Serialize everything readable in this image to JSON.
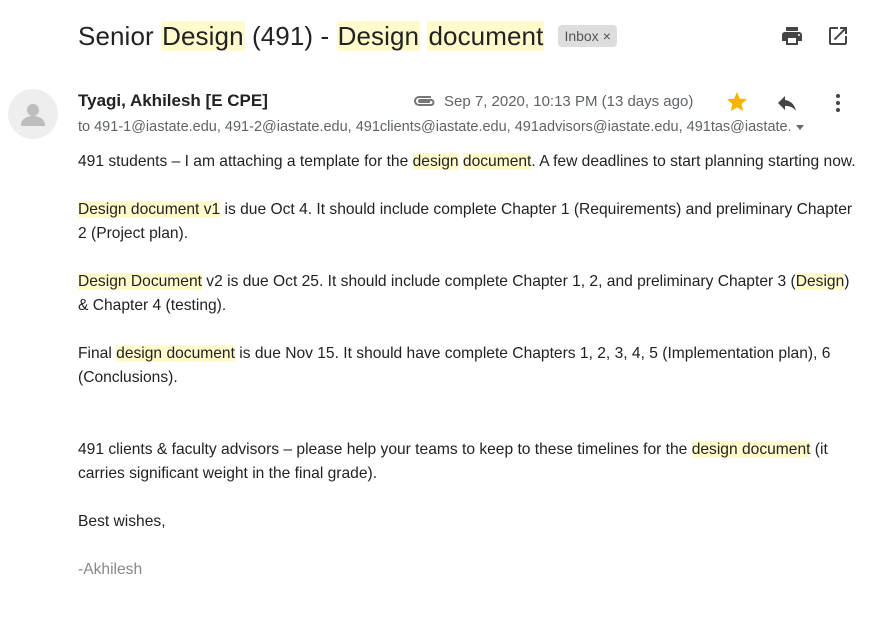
{
  "subject": {
    "parts": [
      {
        "text": "Senior ",
        "hl": false
      },
      {
        "text": "Design",
        "hl": true
      },
      {
        "text": " (491) - ",
        "hl": false
      },
      {
        "text": "Design",
        "hl": true
      },
      {
        "text": " ",
        "hl": false
      },
      {
        "text": "document",
        "hl": true
      }
    ],
    "label": "Inbox",
    "label_close": "×"
  },
  "toolbar": {
    "print_icon": "print-icon",
    "popout_icon": "open-in-new-window-icon"
  },
  "sender": {
    "name": "Tyagi, Akhilesh [E CPE]",
    "date": "Sep 7, 2020, 10:13 PM (13 days ago)",
    "recipients": "to 491-1@iastate.edu, 491-2@iastate.edu, 491clients@iastate.edu, 491advisors@iastate.edu, 491tas@iastate.edu"
  },
  "colors": {
    "highlight": "#fffbcc",
    "star": "#f4b400",
    "chip_bg": "#dddddd"
  },
  "body": [
    [
      {
        "text": "491 students – I am attaching a template for the ",
        "hl": false
      },
      {
        "text": "design",
        "hl": true
      },
      {
        "text": " ",
        "hl": false
      },
      {
        "text": "document",
        "hl": true
      },
      {
        "text": ". A few deadlines to start planning starting now.",
        "hl": false
      }
    ],
    [
      {
        "text": "Design",
        "hl": true
      },
      {
        "text": " ",
        "hl": false
      },
      {
        "text": "document",
        "hl": true
      },
      {
        "text": " ",
        "hl": false
      },
      {
        "text": "v1",
        "hl": true
      },
      {
        "text": " is due Oct 4. It should include complete Chapter 1 (Requirements) and preliminary Chapter 2 (Project plan).",
        "hl": false
      }
    ],
    [
      {
        "text": "Design",
        "hl": true
      },
      {
        "text": " ",
        "hl": false
      },
      {
        "text": "Document",
        "hl": true
      },
      {
        "text": " v2 is due Oct 25. It should include complete Chapter 1, 2, and preliminary Chapter 3 (",
        "hl": false
      },
      {
        "text": "Design",
        "hl": true
      },
      {
        "text": ") & Chapter 4 (testing).",
        "hl": false
      }
    ],
    [
      {
        "text": "Final ",
        "hl": false
      },
      {
        "text": "design",
        "hl": true
      },
      {
        "text": " ",
        "hl": false
      },
      {
        "text": "document",
        "hl": true
      },
      {
        "text": " is due Nov 15. It should have complete Chapters 1, 2, 3, 4, 5 (Implementation plan), 6 (Conclusions).",
        "hl": false
      }
    ],
    [
      {
        "text": "491 clients & faculty advisors – please help your teams to keep to these timelines for the ",
        "hl": false
      },
      {
        "text": "design",
        "hl": true
      },
      {
        "text": " ",
        "hl": false
      },
      {
        "text": "document",
        "hl": true
      },
      {
        "text": " (it carries significant weight in the final grade).",
        "hl": false
      }
    ],
    [
      {
        "text": "Best wishes,",
        "hl": false
      }
    ]
  ],
  "signature": "-Akhilesh"
}
